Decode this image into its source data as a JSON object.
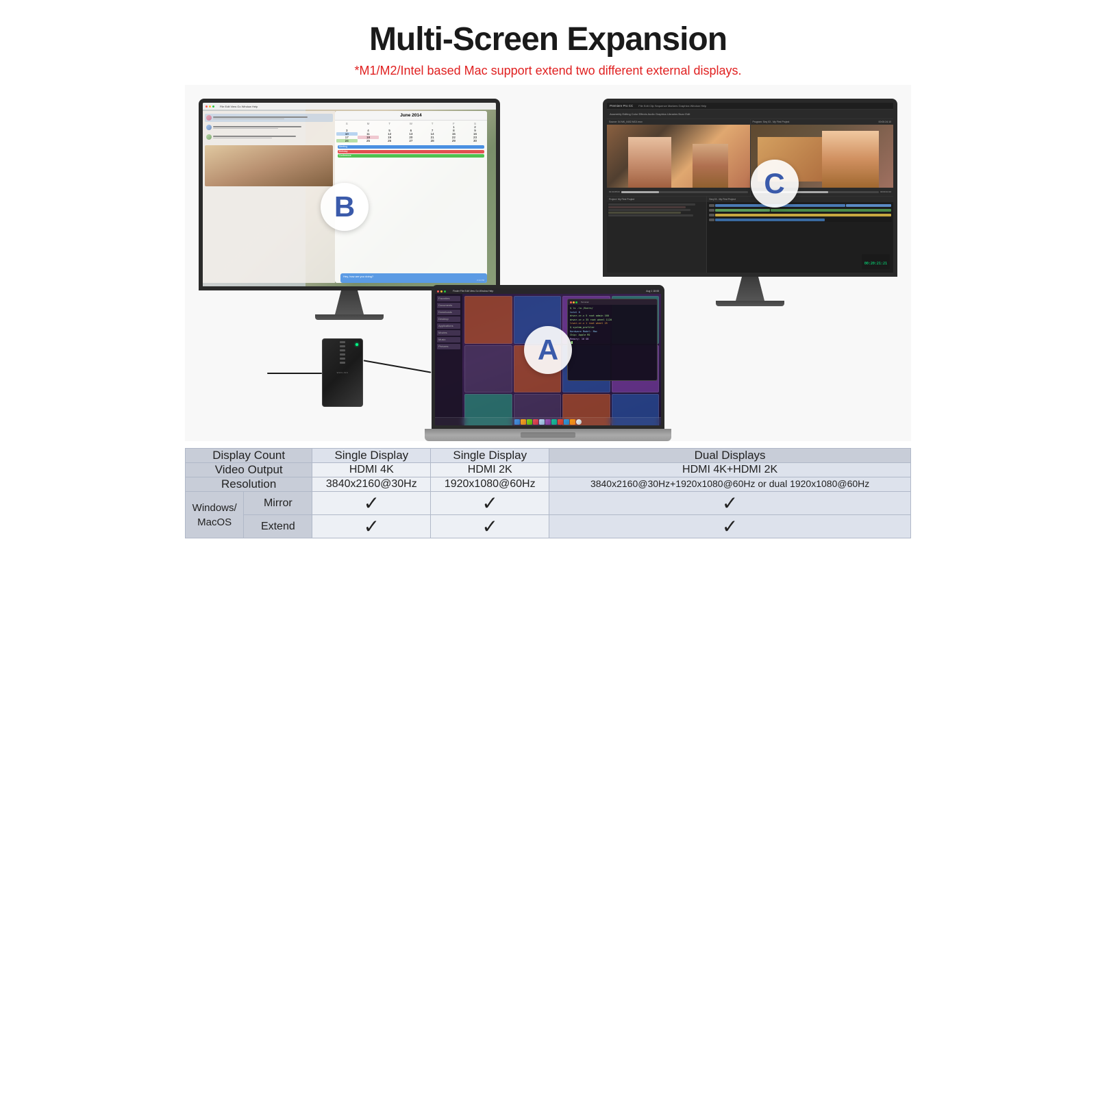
{
  "header": {
    "title": "Multi-Screen Expansion",
    "subtitle_star": "*",
    "subtitle_text": "M1/M2/Intel based Mac support extend two different external displays."
  },
  "labels": {
    "A": "A",
    "B": "B",
    "C": "C"
  },
  "table": {
    "col_headers": [
      "Display Count",
      "Single Display",
      "Dual Displays"
    ],
    "rows": [
      {
        "label": "Video Output",
        "values": [
          "HDMI 4K",
          "HDMI 2K",
          "HDMI 4K+HDMI 2K"
        ]
      },
      {
        "label": "Resolution",
        "values": [
          "3840x2160@30Hz",
          "1920x1080@60Hz",
          "3840x2160@30Hz+1920x1080@60Hz\nor dual 1920x1080@60Hz"
        ]
      }
    ],
    "windows_label": "Windows/\nMacOS",
    "sub_rows": [
      {
        "sub_label": "Mirror",
        "check1": "✓",
        "check2": "✓",
        "check3": "✓"
      },
      {
        "sub_label": "Extend",
        "check1": "✓",
        "check2": "✓",
        "check3": "✓"
      }
    ],
    "checkmark": "✓"
  }
}
